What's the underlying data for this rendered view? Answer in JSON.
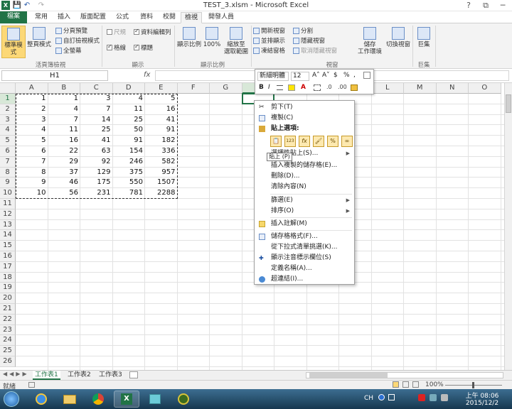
{
  "window": {
    "title": "TEST_3.xlsm - Microsoft Excel",
    "undo": "↶",
    "redo": "↷",
    "minimize": "?",
    "restore": "⧉",
    "close": "─"
  },
  "tabs": [
    "檔案",
    "常用",
    "插入",
    "版面配置",
    "公式",
    "資料",
    "校閱",
    "檢視",
    "開發人員"
  ],
  "ribbon": {
    "workbook_views": {
      "normal": "標準模式",
      "page_layout": "整頁模式",
      "page_break": "分頁預覽",
      "custom": "自訂檢視模式",
      "full_screen": "全螢幕",
      "group": "活頁簿檢視"
    },
    "show": {
      "ruler": "尺規",
      "formula_bar": "資料編輯列",
      "gridlines": "格線",
      "headings": "標題",
      "group": "顯示"
    },
    "zoom": {
      "zoom": "顯示比例",
      "hundred": "100%",
      "zoom_sel_1": "縮放至",
      "zoom_sel_2": "選取範圍",
      "group": "顯示比例"
    },
    "window": {
      "new_window": "開新視窗",
      "arrange_all": "並排顯示",
      "freeze": "凍結窗格",
      "split": "分割",
      "hide": "隱藏視窗",
      "unhide": "取消隱藏視窗",
      "save_ws_1": "儲存",
      "save_ws_2": "工作環境",
      "switch_1": "切換視窗",
      "group": "視窗"
    },
    "macros": {
      "label": "巨集",
      "group": "巨集"
    }
  },
  "formula_bar": {
    "name_box": "H1",
    "fx": "fx"
  },
  "mini_toolbar": {
    "font": "新細明體",
    "size": "12",
    "bold": "B",
    "italic": "I",
    "percent": "%",
    "comma": ",",
    "dollar": "$",
    "grow": "A˄",
    "shrink": "A˅"
  },
  "columns": [
    "A",
    "B",
    "C",
    "D",
    "E",
    "F",
    "G",
    "H",
    "I",
    "J",
    "K",
    "L",
    "M",
    "N",
    "O"
  ],
  "rows": [
    "1",
    "2",
    "3",
    "4",
    "5",
    "6",
    "7",
    "8",
    "9",
    "10",
    "11",
    "12",
    "13",
    "14",
    "15",
    "16",
    "17",
    "18",
    "19",
    "20",
    "21",
    "22",
    "23",
    "24",
    "25",
    "26"
  ],
  "data": [
    [
      "1",
      "1",
      "3",
      "4",
      "5"
    ],
    [
      "2",
      "4",
      "7",
      "11",
      "16"
    ],
    [
      "3",
      "7",
      "14",
      "25",
      "41"
    ],
    [
      "4",
      "11",
      "25",
      "50",
      "91"
    ],
    [
      "5",
      "16",
      "41",
      "91",
      "182"
    ],
    [
      "6",
      "22",
      "63",
      "154",
      "336"
    ],
    [
      "7",
      "29",
      "92",
      "246",
      "582"
    ],
    [
      "8",
      "37",
      "129",
      "375",
      "957"
    ],
    [
      "9",
      "46",
      "175",
      "550",
      "1507"
    ],
    [
      "10",
      "56",
      "231",
      "781",
      "2288"
    ]
  ],
  "context_menu": {
    "cut": "剪下(T)",
    "copy": "複製(C)",
    "paste_options": "貼上選項:",
    "paste_special": "選擇性貼上(S)...",
    "insert_copied": "插入複製的儲存格(E)...",
    "delete": "刪除(D)...",
    "clear": "清除內容(N)",
    "filter": "篩選(E)",
    "sort": "排序(O)",
    "insert_comment": "插入註解(M)",
    "format_cells": "儲存格格式(F)...",
    "pick_list": "從下拉式清單挑選(K)...",
    "phonetic": "顯示注音標示欄位(S)",
    "define_name": "定義名稱(A)...",
    "hyperlink": "超連結(I)..."
  },
  "paste_icons": [
    "📋",
    "123",
    "fx",
    "🖌",
    "%",
    "∞"
  ],
  "tooltip": "貼上 (P)",
  "sheets": [
    "工作表1",
    "工作表2",
    "工作表3"
  ],
  "status": {
    "ready": "就緒",
    "zoom": "100%"
  },
  "taskbar": {
    "lang": "CH",
    "time": "上午 08:06",
    "date": "2015/12/2"
  },
  "colors": {
    "excel_green": "#217346",
    "taskbar": "#1f4d6e"
  }
}
